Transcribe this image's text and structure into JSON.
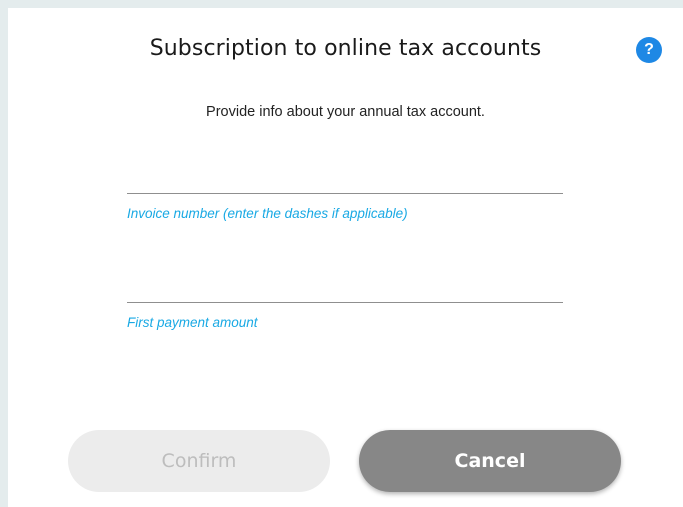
{
  "dialog": {
    "title": "Subscription to online tax accounts",
    "help_icon": "question-mark-icon",
    "help_glyph": "?",
    "subtitle": "Provide info about your annual tax account."
  },
  "fields": {
    "invoice": {
      "value": "",
      "label": "Invoice number (enter the dashes if applicable)"
    },
    "payment": {
      "value": "",
      "label": "First payment amount"
    }
  },
  "buttons": {
    "confirm_label": "Confirm",
    "cancel_label": "Cancel"
  },
  "colors": {
    "accent": "#19a9e4",
    "help": "#1e88e5",
    "cancel_bg": "#878787",
    "confirm_disabled_bg": "#ececec",
    "page_bg": "#e4eced"
  }
}
